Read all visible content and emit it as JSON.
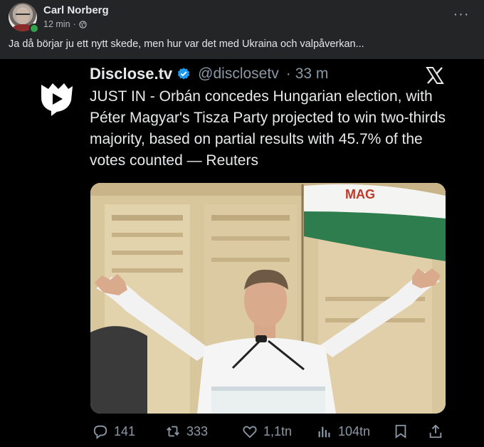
{
  "post": {
    "author": "Carl Norberg",
    "time": "12 min",
    "separator": "·",
    "privacy_icon": "globe-icon",
    "more_icon": "ellipsis-icon",
    "more_label": "···",
    "caption": "Ja då börjar ju ett nytt skede, men hur var det med Ukraina och valpåverkan..."
  },
  "tweet": {
    "name": "Disclose.tv",
    "handle": "@disclosetv",
    "dot": "·",
    "time": "33 m",
    "text": "JUST IN - Orbán concedes Hungarian election, with Péter Magyar's Tisza Party projected to win two-thirds majority, based on partial results with 45.7% of the votes counted — Reuters",
    "photo_flag_text": "MAG",
    "actions": {
      "replies": "141",
      "reposts": "333",
      "likes": "1,1tn",
      "views": "104tn"
    }
  },
  "colors": {
    "background": "#242526",
    "tweet_bg": "#000000",
    "verified": "#1d9bf0",
    "online": "#31a24c",
    "muted": "#8b98a5"
  }
}
